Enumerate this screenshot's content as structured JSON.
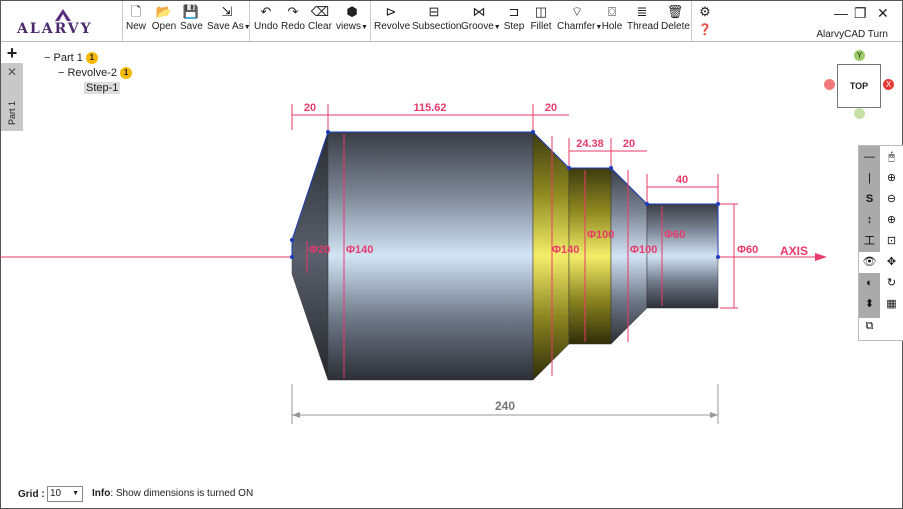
{
  "app": {
    "logo_text": "ALARVY",
    "name": "AlarvyCAD Turn"
  },
  "toolbar": {
    "file": [
      "New",
      "Open",
      "Save",
      "Save As"
    ],
    "edit": [
      "Undo",
      "Redo",
      "Clear",
      "views"
    ],
    "ops": [
      "Revolve",
      "Subsection",
      "Groove",
      "Step",
      "Fillet",
      "Chamfer",
      "Hole",
      "Thread",
      "Delete"
    ]
  },
  "sidebar": {
    "tab_label": "Part 1"
  },
  "tree": {
    "part": {
      "label": "Part 1",
      "badge": "1"
    },
    "revolve": {
      "label": "Revolve-2",
      "badge": "1"
    },
    "step": {
      "label": "Step-1"
    }
  },
  "viewcube": {
    "face": "TOP",
    "y": "Y",
    "x": "X"
  },
  "drawing": {
    "dims_top": [
      "20",
      "115.62",
      "20",
      "24.38",
      "20",
      "40"
    ],
    "diameters": [
      "Φ20",
      "Φ140",
      "Φ140",
      "Φ100",
      "Φ100",
      "Φ60",
      "Φ60"
    ],
    "overall": "240",
    "axis_label": "AXIS"
  },
  "righttools": {
    "left": [
      "—",
      "|",
      "S",
      "↕",
      "工",
      "👁",
      "◐",
      "⬍"
    ],
    "right": [
      "⊕",
      "⊕",
      "⊖",
      "⊕",
      "⊡",
      "✥",
      "↻",
      "▦"
    ]
  },
  "footer": {
    "grid_label": "Grid :",
    "grid_value": "10",
    "info_label": "Info",
    "info_text": ": Show dimensions is turned ON"
  }
}
